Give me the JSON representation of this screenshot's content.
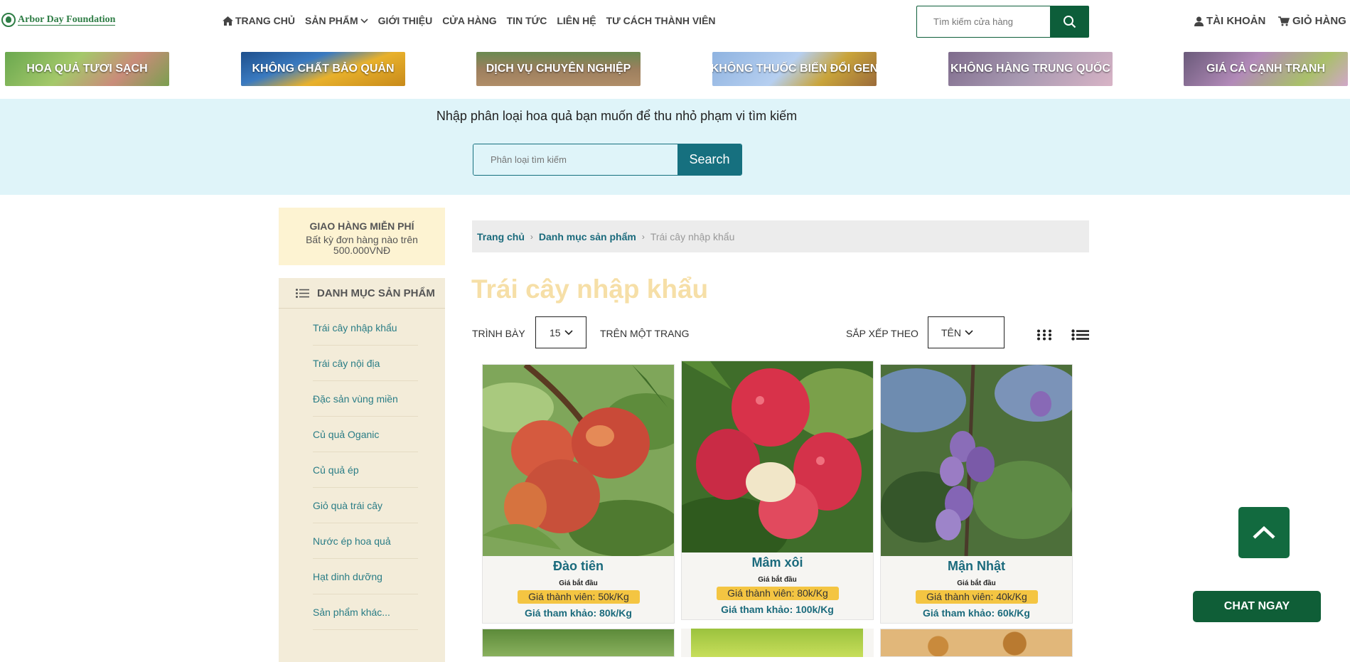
{
  "header": {
    "logo_text": "Arbor Day Foundation",
    "nav": [
      "TRANG CHỦ",
      "SẢN PHẨM",
      "GIỚI THIỆU",
      "CỬA HÀNG",
      "TIN TỨC",
      "LIÊN HỆ",
      "TƯ CÁCH THÀNH VIÊN"
    ],
    "search_placeholder": "Tìm kiếm cửa hàng",
    "account": "TÀI KHOẢN",
    "cart": "GIỎ HÀNG"
  },
  "banners": [
    "HOA QUẢ TƯƠI SẠCH",
    "KHÔNG CHẤT BẢO QUẢN",
    "DỊCH VỤ CHUYÊN NGHIỆP",
    "KHÔNG THUỐC BIẾN ĐỔI GEN",
    "KHÔNG HÀNG TRUNG QUỐC",
    "GIÁ CẢ CẠNH TRANH"
  ],
  "filter": {
    "prompt": "Nhập phân loại hoa quả bạn muốn để thu nhỏ phạm vi tìm kiếm",
    "placeholder": "Phân loại tìm kiếm",
    "button": "Search"
  },
  "shipping": {
    "title": "GIAO HÀNG MIỄN PHÍ",
    "text": "Bất kỳ đơn hàng nào trên 500.000VNĐ"
  },
  "categories": {
    "title": "DANH MỤC SẢN PHẨM",
    "items": [
      "Trái cây nhập khẩu",
      "Trái cây nội địa",
      "Đặc sản vùng miền",
      "Củ quả Oganic",
      "Củ quả ép",
      "Giỏ quà trái cây",
      "Nước ép hoa quả",
      "Hạt dinh dưỡng",
      "Sản phẩm khác..."
    ]
  },
  "breadcrumb": [
    "Trang chủ",
    "Danh mục sản phẩm",
    "Trái cây nhập khẩu"
  ],
  "page_title": "Trái cây nhập khẩu",
  "controls": {
    "show_label": "TRÌNH BÀY",
    "per_page_value": "15",
    "per_page_label": "TRÊN MỘT TRANG",
    "sort_label": "SẮP XẾP THEO",
    "sort_value": "TÊN"
  },
  "products": [
    {
      "name": "Đào tiên",
      "from": "Giá bắt đầu",
      "member": "Giá thành viên: 50k/Kg",
      "ref": "Giá tham khảo: 80k/Kg"
    },
    {
      "name": "Mâm xôi",
      "from": "Giá bắt đầu",
      "member": "Giá thành viên: 80k/Kg",
      "ref": "Giá tham khảo: 100k/Kg"
    },
    {
      "name": "Mận Nhật",
      "from": "Giá bắt đầu",
      "member": "Giá thành viên: 40k/Kg",
      "ref": "Giá tham khảo: 60k/Kg"
    }
  ],
  "chat_button": "CHAT NGAY",
  "colors": {
    "brand_green": "#0d5e3a",
    "teal": "#16707f",
    "price_tag": "#f4c542"
  }
}
